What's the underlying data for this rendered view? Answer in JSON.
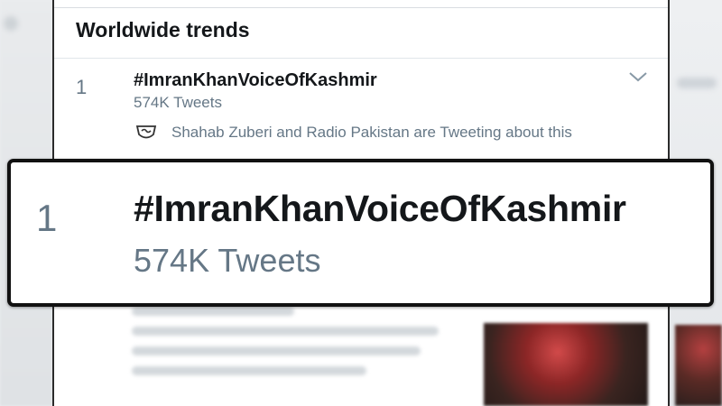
{
  "section": {
    "title": "Worldwide trends"
  },
  "trend": {
    "rank": "1",
    "name": "#ImranKhanVoiceOfKashmir",
    "tweet_count": "574K Tweets",
    "context": "Shahab Zuberi and Radio Pakistan are Tweeting about this",
    "context_icon": "verified-org-badge-icon",
    "menu_icon": "chevron-down-icon"
  },
  "zoom": {
    "rank": "1",
    "name": "#ImranKhanVoiceOfKashmir",
    "tweet_count": "574K Tweets"
  },
  "colors": {
    "primary_text": "#14171a",
    "secondary_text": "#657786",
    "callout_border": "#111111"
  }
}
